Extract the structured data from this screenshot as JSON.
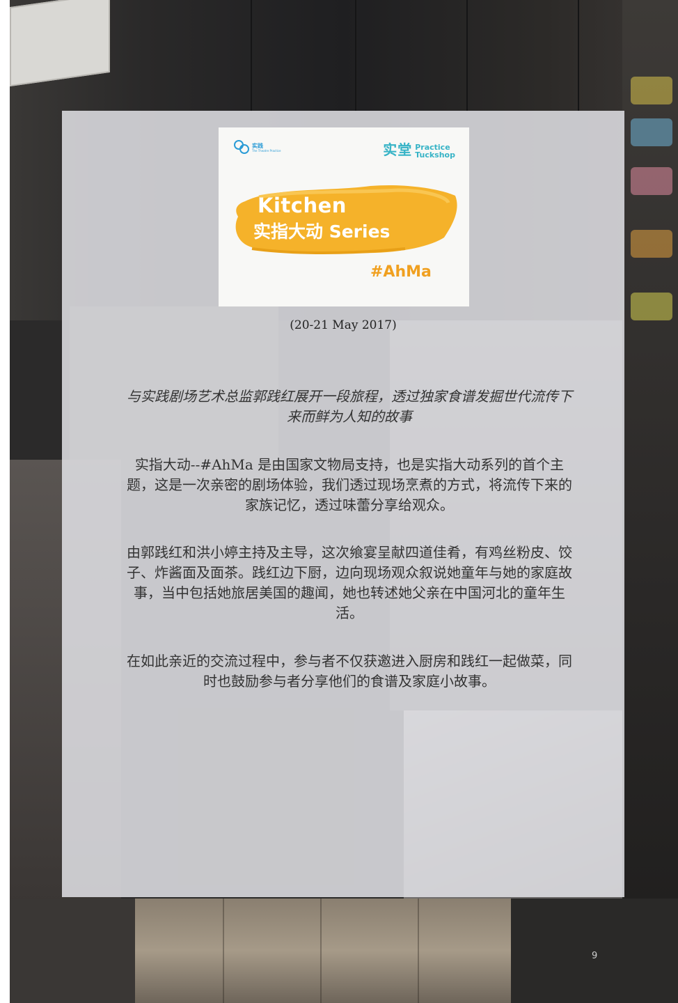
{
  "logo_card": {
    "left_logo_name": "实践",
    "left_logo_sub": "The Theatre Practice",
    "right_logo_cn": "实堂",
    "right_logo_en_line1": "Practice",
    "right_logo_en_line2": "Tuckshop",
    "title_line1": "Kitchen",
    "title_line2": "实指大动 Series",
    "hashtag": "#AhMa",
    "brush_color": "#f5b22a"
  },
  "date": "(20-21 May 2017)",
  "intro": "与实践剧场艺术总监郭践红展开一段旅程，透过独家食谱发掘世代流传下来而鲜为人知的故事",
  "paragraphs": [
    "实指大动--#AhMa 是由国家文物局支持，也是实指大动系列的首个主题，这是一次亲密的剧场体验，我们透过现场烹煮的方式，将流传下来的家族记忆，透过味蕾分享给观众。",
    "由郭践红和洪小婷主持及主导，这次飨宴呈献四道佳肴，有鸡丝粉皮、饺子、炸酱面及面茶。践红边下厨，边向现场观众叙说她童年与她的家庭故事，当中包括她旅居美国的趣闻，她也转述她父亲在中国河北的童年生活。",
    "在如此亲近的交流过程中，参与者不仅获邀进入厨房和践红一起做菜，同时也鼓励参与者分享他们的食谱及家庭小故事。"
  ],
  "page_number": "9",
  "colors": {
    "panel": "#e2e2e6",
    "text": "#333333",
    "accent_teal": "#36b3c6",
    "accent_blue": "#2a9bd6",
    "accent_orange": "#f0a020"
  }
}
